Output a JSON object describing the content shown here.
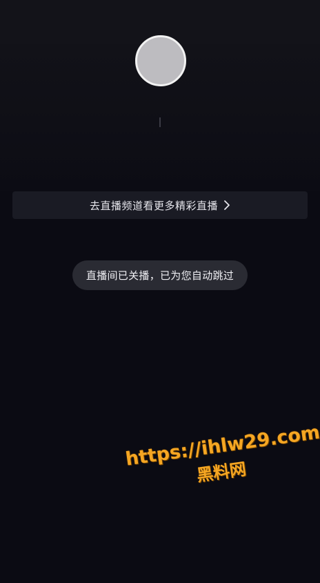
{
  "channel_link": {
    "label": "去直播频道看更多精彩直播",
    "icon": "chevron-right-icon"
  },
  "toast": {
    "message": "直播间已关播，已为您自动跳过"
  },
  "watermark": {
    "url": "https://ihlw29.com",
    "name": "黑料网",
    "color": "#f5a623"
  },
  "colors": {
    "background": "#0b0b13",
    "bar": "#1a1b24",
    "toast": "#2a2b33",
    "avatar": "#bdbcc0"
  }
}
